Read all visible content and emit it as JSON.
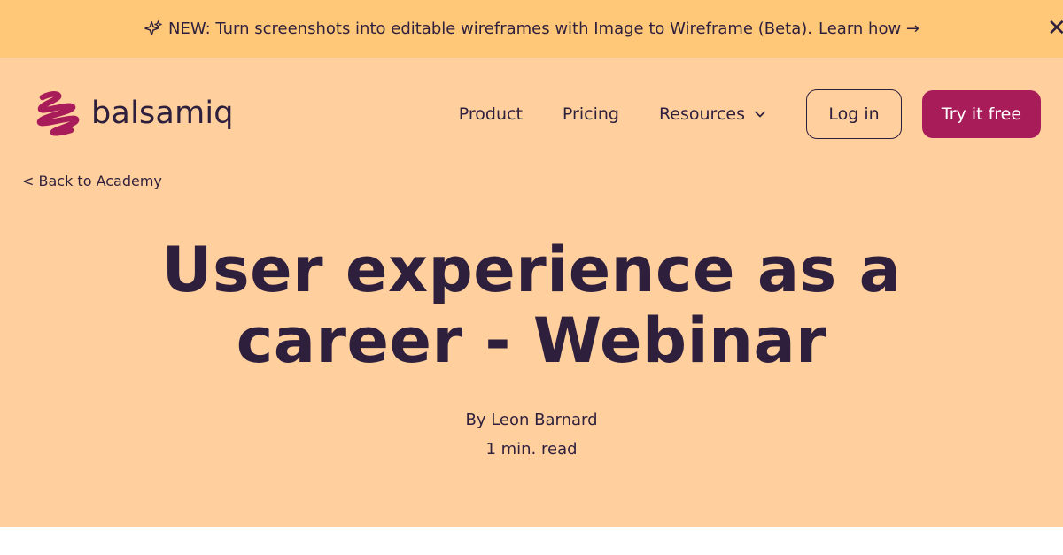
{
  "banner": {
    "message": "NEW: Turn screenshots into editable wireframes with Image to Wireframe (Beta).",
    "link": "Learn how →",
    "close": "✕"
  },
  "header": {
    "logo_text": "balsamiq",
    "nav": {
      "product": "Product",
      "pricing": "Pricing",
      "resources": "Resources",
      "login": "Log in",
      "try": "Try it free"
    }
  },
  "breadcrumb": {
    "back": "< Back to Academy"
  },
  "article": {
    "title": "User experience as a career - Webinar",
    "author": "By Leon Barnard",
    "read_time": "1 min. read"
  },
  "colors": {
    "banner_bg": "#ffc878",
    "hero_bg": "#ffd09d",
    "text": "#2e1f3d",
    "accent": "#a81c5a"
  },
  "icons": {
    "banner": "sparkle-icon",
    "logo": "balsamiq-squiggle-icon",
    "resources": "chevron-down-icon",
    "close": "close-icon"
  }
}
